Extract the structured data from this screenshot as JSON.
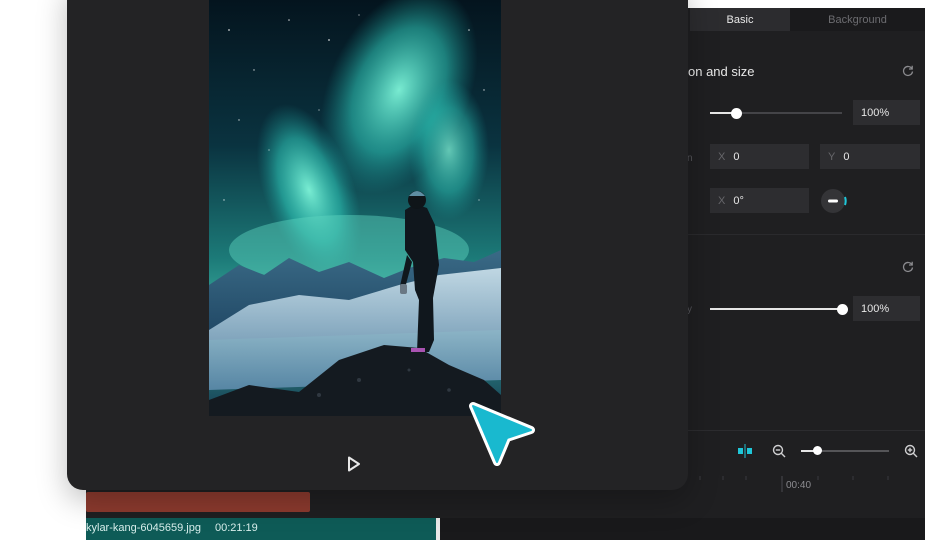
{
  "panel": {
    "tabs": [
      "Basic",
      "Background"
    ],
    "section1_title": "on and size",
    "scale_value": "100%",
    "position_label_fragment": "n",
    "position_x_prefix": "X",
    "position_x_value": "0",
    "position_y_prefix": "Y",
    "position_y_value": "0",
    "rotation_x_prefix": "X",
    "rotation_value": "0°",
    "opacity_label_fragment": "y",
    "opacity_value": "100%"
  },
  "levels": {
    "scale_fraction": 0.2,
    "opacity_fraction": 1.0,
    "zoom_fraction": 0.18
  },
  "timeline": {
    "ruler_time": "00:40",
    "clip_name": "kylar-kang-6045659.jpg",
    "clip_duration": "00:21:19"
  },
  "colors": {
    "accent": "#1fc6d8",
    "clip_teal": "#0e5b57",
    "track_red": "#8c3a2e",
    "panel_bg": "#1f1f21"
  },
  "icons": {
    "reset": "reset-icon",
    "play": "play-icon",
    "zoom_out": "zoom-out-icon",
    "zoom_in": "zoom-in-icon",
    "split": "split-icon",
    "cursor": "pointer-cursor-icon"
  }
}
